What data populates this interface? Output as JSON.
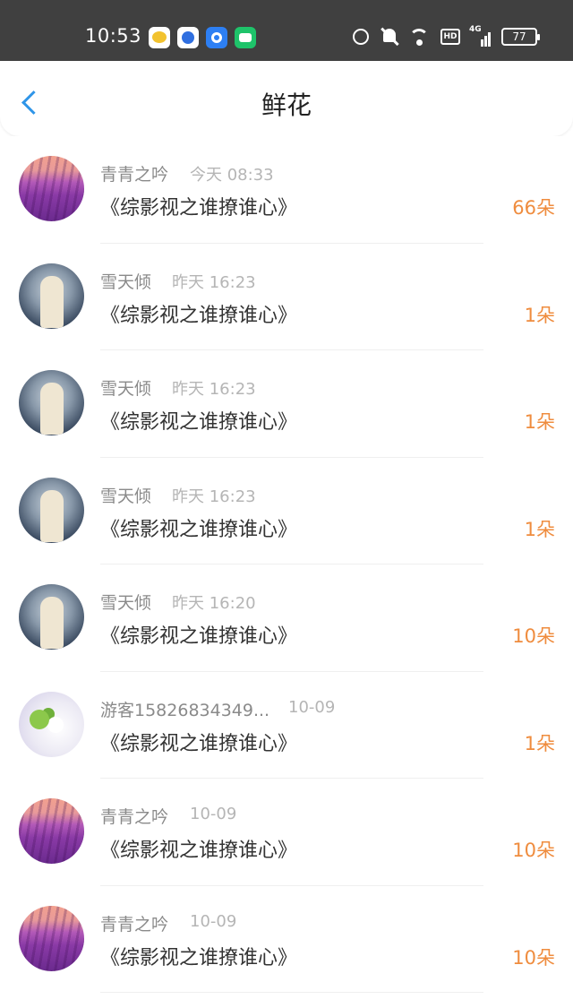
{
  "status_bar": {
    "time": "10:53",
    "network_label": "4G",
    "hd_label": "HD",
    "battery": "77",
    "app_icons": [
      "weather-app-icon",
      "baidu-app-icon",
      "browser-app-icon",
      "messages-app-icon"
    ],
    "system_icons": [
      "alarm-icon",
      "mute-icon",
      "wifi-icon",
      "hd-icon",
      "signal-icon",
      "battery-icon"
    ]
  },
  "header": {
    "title": "鲜花",
    "back_icon": "chevron-left-icon"
  },
  "colors": {
    "accent": "#2f95e8",
    "count": "#ef8c3e",
    "status_bar_bg": "#404040"
  },
  "rows": [
    {
      "name": "青青之吟",
      "time": "今天 08:33",
      "book": "《综影视之谁撩谁心》",
      "count": "66朵",
      "avatar": "lavender-field"
    },
    {
      "name": "雪天倾",
      "time": "昨天 16:23",
      "book": "《综影视之谁撩谁心》",
      "count": "1朵",
      "avatar": "lady-in-white"
    },
    {
      "name": "雪天倾",
      "time": "昨天 16:23",
      "book": "《综影视之谁撩谁心》",
      "count": "1朵",
      "avatar": "lady-in-white"
    },
    {
      "name": "雪天倾",
      "time": "昨天 16:23",
      "book": "《综影视之谁撩谁心》",
      "count": "1朵",
      "avatar": "lady-in-white"
    },
    {
      "name": "雪天倾",
      "time": "昨天 16:20",
      "book": "《综影视之谁撩谁心》",
      "count": "10朵",
      "avatar": "lady-in-white"
    },
    {
      "name": "游客15826834349...",
      "time": "10-09",
      "book": "《综影视之谁撩谁心》",
      "count": "1朵",
      "avatar": "white-flowers"
    },
    {
      "name": "青青之吟",
      "time": "10-09",
      "book": "《综影视之谁撩谁心》",
      "count": "10朵",
      "avatar": "lavender-field"
    },
    {
      "name": "青青之吟",
      "time": "10-09",
      "book": "《综影视之谁撩谁心》",
      "count": "10朵",
      "avatar": "lavender-field"
    }
  ]
}
